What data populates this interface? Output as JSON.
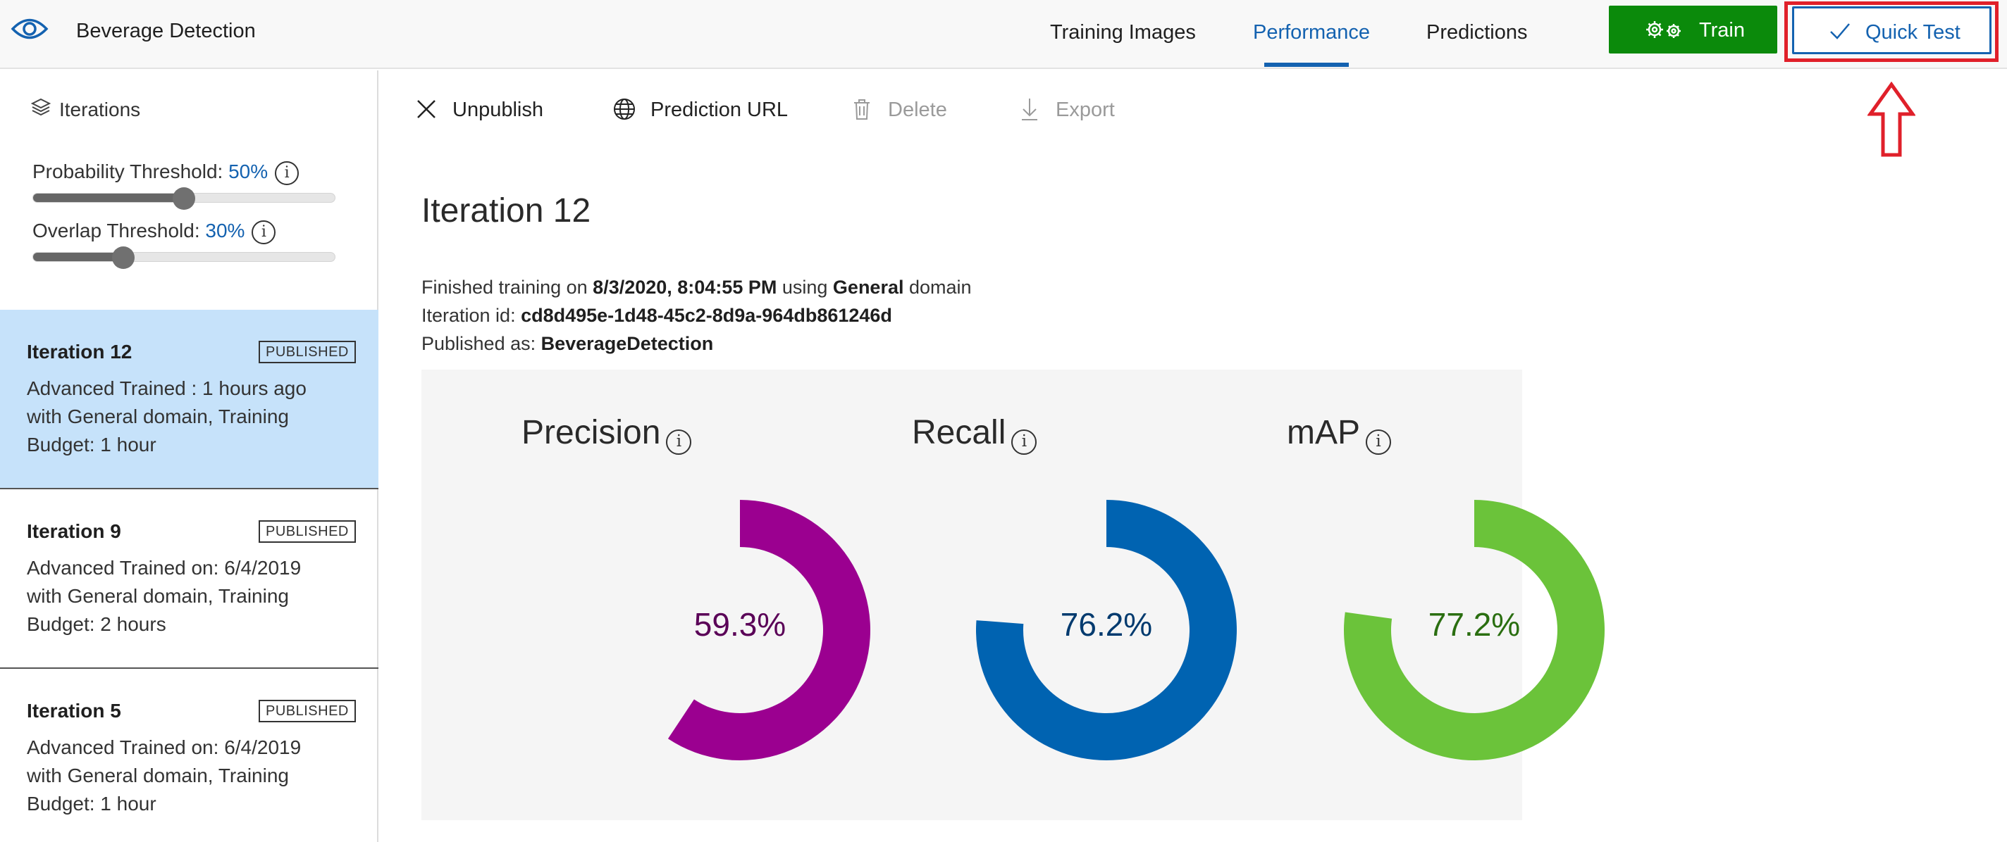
{
  "app": {
    "title": "Beverage Detection",
    "logo_icon": "eye-icon"
  },
  "nav": {
    "tabs": [
      {
        "label": "Training Images",
        "active": false
      },
      {
        "label": "Performance",
        "active": true
      },
      {
        "label": "Predictions",
        "active": false
      }
    ],
    "train_label": "Train",
    "train_icon": "gears-icon",
    "quick_test_label": "Quick Test",
    "quick_test_icon": "checkmark-icon"
  },
  "sidebar": {
    "heading": "Iterations",
    "probability": {
      "label": "Probability Threshold:",
      "value": "50%",
      "level": 0.5
    },
    "overlap": {
      "label": "Overlap Threshold:",
      "value": "30%",
      "level": 0.3
    },
    "items": [
      {
        "name": "Iteration 12",
        "badge": "PUBLISHED",
        "desc": "Advanced Trained : 1 hours ago with General domain, Training Budget: 1 hour",
        "selected": true
      },
      {
        "name": "Iteration 9",
        "badge": "PUBLISHED",
        "desc": "Advanced Trained on: 6/4/2019 with General domain, Training Budget: 2 hours",
        "selected": false
      },
      {
        "name": "Iteration 5",
        "badge": "PUBLISHED",
        "desc": "Advanced Trained on: 6/4/2019 with General domain, Training Budget: 1 hour",
        "selected": false
      }
    ]
  },
  "toolbar": {
    "unpublish": "Unpublish",
    "prediction_url": "Prediction URL",
    "delete": "Delete",
    "export": "Export"
  },
  "detail": {
    "title": "Iteration 12",
    "finished_prefix": "Finished training on",
    "finished_date": "8/3/2020, 8:04:55 PM",
    "using": "using",
    "domain": "General",
    "domain_suffix": "domain",
    "iteration_id_label": "Iteration id:",
    "iteration_id": "cd8d495e-1d48-45c2-8d9a-964db861246d",
    "published_label": "Published as:",
    "published_name": "BeverageDetection"
  },
  "metrics": [
    {
      "name": "Precision",
      "value_text": "59.3%",
      "value": 0.593,
      "color": "#9b0090",
      "text_color": "#5a0057"
    },
    {
      "name": "Recall",
      "value_text": "76.2%",
      "value": 0.762,
      "color": "#0063b1",
      "text_color": "#003a6e"
    },
    {
      "name": "mAP",
      "value_text": "77.2%",
      "value": 0.772,
      "color": "#6bc33a",
      "text_color": "#2a6e10"
    }
  ],
  "colors": {
    "accent": "#1462b0",
    "train_green": "#0b8a0b",
    "highlight_red": "#e0202a",
    "selected_bg": "#c6e2fa"
  }
}
